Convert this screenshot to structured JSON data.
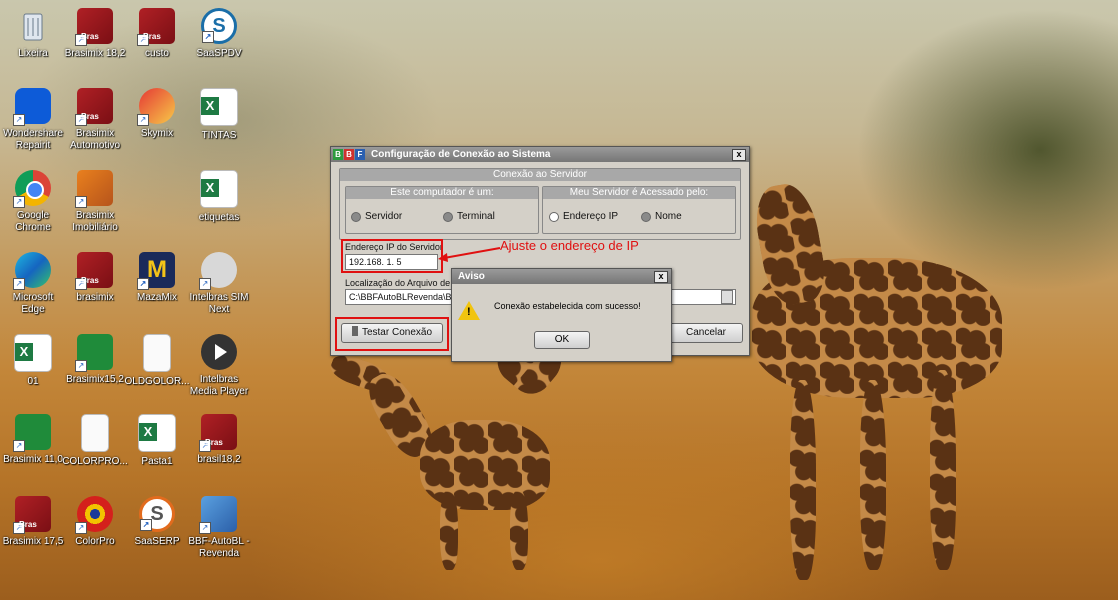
{
  "desktop": {
    "icons": [
      {
        "label": "Lixeira",
        "icon": "recycle-bin-icon"
      },
      {
        "label": "Brasimix 18,2",
        "icon": "brasimix-icon"
      },
      {
        "label": "custo",
        "icon": "brasimix-icon"
      },
      {
        "label": "SaaSPDV",
        "icon": "saas-icon"
      },
      {
        "label": "Wondershare Repairit",
        "icon": "wondershare-icon"
      },
      {
        "label": "Brasimix Automotivo",
        "icon": "brasimix-icon"
      },
      {
        "label": "Skymix",
        "icon": "skymix-icon"
      },
      {
        "label": "TINTAS",
        "icon": "excel-icon"
      },
      {
        "label": "Google Chrome",
        "icon": "chrome-icon"
      },
      {
        "label": "Brasimix Imobiliário",
        "icon": "house-icon"
      },
      {
        "label": "etiquetas",
        "icon": "excel-icon"
      },
      {
        "label": "Microsoft Edge",
        "icon": "edge-icon"
      },
      {
        "label": "brasimix",
        "icon": "brasimix-icon"
      },
      {
        "label": "MazaMix",
        "icon": "mazamix-icon"
      },
      {
        "label": "Intelbras SIM Next",
        "icon": "intelbras-icon"
      },
      {
        "label": "01",
        "icon": "excel-icon"
      },
      {
        "label": "Brasimix15,2",
        "icon": "brasilux-icon"
      },
      {
        "label": "OLDGOLOR...",
        "icon": "document-icon"
      },
      {
        "label": "Intelbras Media Player",
        "icon": "media-player-icon"
      },
      {
        "label": "Brasimix 11,0",
        "icon": "brasilux-icon"
      },
      {
        "label": "COLORPRO...",
        "icon": "document-icon"
      },
      {
        "label": "Pasta1",
        "icon": "excel-icon"
      },
      {
        "label": "brasil18,2",
        "icon": "brasimix-icon"
      },
      {
        "label": "Brasimix 17,5",
        "icon": "brasimix-icon"
      },
      {
        "label": "ColorPro",
        "icon": "colorpro-icon"
      },
      {
        "label": "SaaSERP",
        "icon": "saaserp-icon"
      },
      {
        "label": "BBF-AutoBL - Revenda",
        "icon": "bbf-icon"
      }
    ]
  },
  "dialog": {
    "logo": [
      "B",
      "B",
      "F"
    ],
    "title": "Configuração de Conexão ao Sistema",
    "close": "x",
    "section_title": "Conexão ao Servidor",
    "computer_group": {
      "title": "Este computador é um:",
      "options": [
        "Servidor",
        "Terminal"
      ]
    },
    "server_group": {
      "title": "Meu Servidor é Acessado pelo:",
      "options": [
        "Endereço IP",
        "Nome"
      ]
    },
    "ip_label": "Endereço IP do Servidor",
    "ip_value": "192.168.  1.  5",
    "db_label": "Localização do Arquivo de B",
    "db_value": "C:\\BBFAutoBLRevenda\\Ba",
    "test_button": "Testar Conexão",
    "cancel_button": "Cancelar"
  },
  "annotation": {
    "text": "Ajuste o endereço de IP",
    "color": "#e01010"
  },
  "alert": {
    "title": "Aviso",
    "close": "x",
    "message": "Conexão estabelecida com sucesso!",
    "ok_button": "OK"
  }
}
